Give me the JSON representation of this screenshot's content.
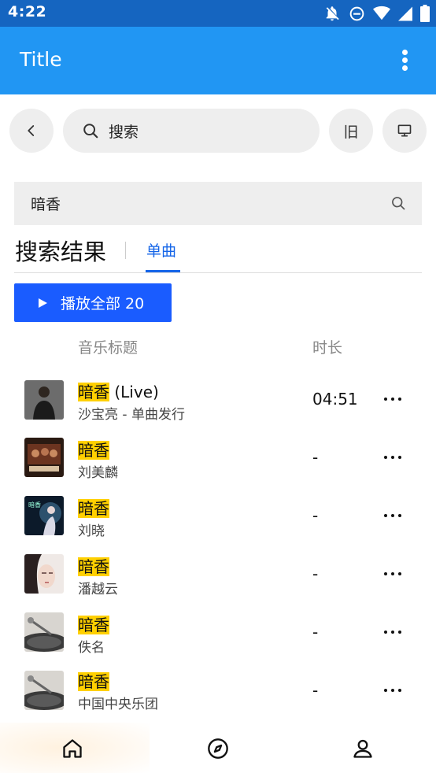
{
  "status_bar": {
    "time": "4:22"
  },
  "app_bar": {
    "title": "Title"
  },
  "toolbar": {
    "search_label": "搜索",
    "old_label": "旧"
  },
  "search": {
    "query": "暗香"
  },
  "results": {
    "heading": "搜索结果",
    "tab_single": "单曲"
  },
  "play_all": {
    "label": "播放全部 20"
  },
  "columns": {
    "title": "音乐标题",
    "duration": "时长"
  },
  "songs": [
    {
      "title_hl": "暗香",
      "title_rest": " (Live)",
      "artist": "沙宝亮 - 单曲发行",
      "duration": "04:51"
    },
    {
      "title_hl": "暗香",
      "title_rest": "",
      "artist": "刘美麟",
      "duration": "-"
    },
    {
      "title_hl": "暗香",
      "title_rest": "",
      "artist": "刘晓",
      "duration": "-"
    },
    {
      "title_hl": "暗香",
      "title_rest": "",
      "artist": "潘越云",
      "duration": "-"
    },
    {
      "title_hl": "暗香",
      "title_rest": "",
      "artist": "佚名",
      "duration": "-"
    },
    {
      "title_hl": "暗香",
      "title_rest": "",
      "artist": "中国中央乐团",
      "duration": "-"
    }
  ],
  "colors": {
    "status_bar": "#1565c0",
    "app_bar": "#2196f3",
    "accent": "#1a5cff",
    "highlight": "#ffd000"
  },
  "bottom_nav": {
    "icons": [
      "home-icon",
      "compass-icon",
      "person-icon"
    ]
  }
}
